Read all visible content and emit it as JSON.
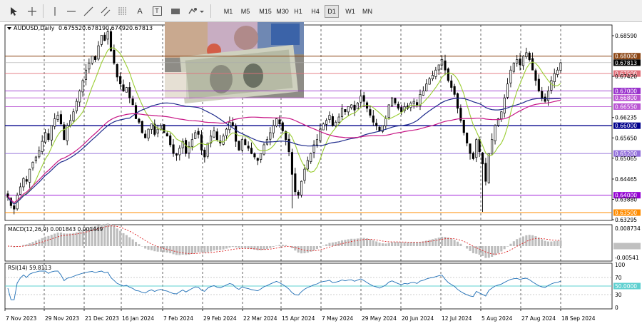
{
  "toolbar": {
    "tools": [
      {
        "name": "cursor-icon"
      },
      {
        "name": "crosshair-icon"
      },
      {
        "name": "vertical-line-icon"
      },
      {
        "name": "horizontal-line-icon"
      },
      {
        "name": "trendline-icon"
      },
      {
        "name": "equidistant-channel-icon"
      },
      {
        "name": "fibonacci-icon"
      },
      {
        "name": "text-icon"
      },
      {
        "name": "text-label-icon"
      },
      {
        "name": "rectangle-icon"
      },
      {
        "name": "shapes-dropdown-icon"
      }
    ],
    "text_tool": "A",
    "text_label_tool": "T",
    "timeframes": [
      "M1",
      "M5",
      "M15",
      "M30",
      "H1",
      "H4",
      "D1",
      "W1",
      "MN"
    ],
    "active_timeframe": "D1"
  },
  "chart": {
    "header": {
      "symbol": "AUDUSD,Daily",
      "open": "0.67552",
      "high": "0.67819",
      "low": "0.67492",
      "close": "0.67813"
    },
    "price_axis": [
      "0.68590",
      "0.67420",
      "0.66235",
      "0.65650",
      "0.65065",
      "0.64465",
      "0.63880",
      "0.63295"
    ],
    "current_price": "0.67813",
    "levels": [
      {
        "label": "0.68000",
        "value": 0.68,
        "color": "#8b4513"
      },
      {
        "label": "0.67500",
        "value": 0.675,
        "color": "#e0707a"
      },
      {
        "label": "0.67000",
        "value": 0.67,
        "color": "#9932cc"
      },
      {
        "label": "0.66800",
        "value": 0.668,
        "color": "#ba55d3"
      },
      {
        "label": "0.66550",
        "value": 0.6655,
        "color": "#ba55d3"
      },
      {
        "label": "0.66000",
        "value": 0.66,
        "color": "#00008b"
      },
      {
        "label": "0.65200",
        "value": 0.652,
        "color": "#9370db"
      },
      {
        "label": "0.64000",
        "value": 0.64,
        "color": "#9400d3"
      },
      {
        "label": "0.63500",
        "value": 0.635,
        "color": "#ff8c00"
      }
    ],
    "date_axis": [
      "7 Nov 2023",
      "29 Nov 2023",
      "21 Dec 2023",
      "16 Jan 2024",
      "7 Feb 2024",
      "29 Feb 2024",
      "22 Mar 2024",
      "15 Apr 2024",
      "7 May 2024",
      "29 May 2024",
      "20 Jun 2024",
      "12 Jul 2024",
      "5 Aug 2024",
      "27 Aug 2024",
      "18 Sep 2024"
    ],
    "closes": [
      0.6394,
      0.637,
      0.636,
      0.64,
      0.6424,
      0.6448,
      0.644,
      0.6475,
      0.6495,
      0.651,
      0.6528,
      0.6555,
      0.658,
      0.656,
      0.66,
      0.662,
      0.663,
      0.6605,
      0.656,
      0.66,
      0.6615,
      0.664,
      0.667,
      0.67,
      0.673,
      0.676,
      0.678,
      0.68,
      0.679,
      0.683,
      0.686,
      0.6845,
      0.687,
      0.6815,
      0.678,
      0.674,
      0.672,
      0.67,
      0.671,
      0.668,
      0.666,
      0.662,
      0.661,
      0.658,
      0.6565,
      0.659,
      0.6605,
      0.6575,
      0.659,
      0.66,
      0.658,
      0.657,
      0.6545,
      0.652,
      0.6515,
      0.6535,
      0.6555,
      0.652,
      0.654,
      0.656,
      0.658,
      0.6575,
      0.653,
      0.651,
      0.655,
      0.657,
      0.6585,
      0.656,
      0.655,
      0.657,
      0.659,
      0.661,
      0.66,
      0.6555,
      0.653,
      0.656,
      0.6545,
      0.6535,
      0.652,
      0.651,
      0.65,
      0.652,
      0.6545,
      0.656,
      0.658,
      0.66,
      0.662,
      0.6605,
      0.6585,
      0.656,
      0.6525,
      0.646,
      0.641,
      0.64,
      0.644,
      0.6475,
      0.65,
      0.652,
      0.6545,
      0.656,
      0.659,
      0.6605,
      0.6615,
      0.663,
      0.66,
      0.661,
      0.6625,
      0.665,
      0.664,
      0.6655,
      0.666,
      0.6645,
      0.6665,
      0.6685,
      0.667,
      0.665,
      0.663,
      0.661,
      0.66,
      0.6585,
      0.66,
      0.662,
      0.666,
      0.668,
      0.6665,
      0.665,
      0.664,
      0.6655,
      0.665,
      0.6665,
      0.667,
      0.666,
      0.669,
      0.67,
      0.672,
      0.6735,
      0.6745,
      0.676,
      0.6775,
      0.679,
      0.676,
      0.673,
      0.671,
      0.669,
      0.665,
      0.6615,
      0.658,
      0.655,
      0.652,
      0.6505,
      0.656,
      0.6525,
      0.649,
      0.644,
      0.652,
      0.656,
      0.66,
      0.662,
      0.664,
      0.668,
      0.672,
      0.676,
      0.678,
      0.679,
      0.6775,
      0.68,
      0.681,
      0.679,
      0.676,
      0.673,
      0.67,
      0.668,
      0.667,
      0.67,
      0.673,
      0.675,
      0.676,
      0.6781
    ],
    "ma_fast_color": "#9acd32",
    "ma_mid_color": "#1e2a8c",
    "ma_slow_color": "#c71585",
    "macd": {
      "label": "MACD(12,26,9) 0.001843 0.001449",
      "axis": [
        "0.008734",
        "0.000000",
        "-0.00541"
      ]
    },
    "rsi": {
      "label": "RSI(14) 59.8113",
      "axis": [
        "100",
        "70",
        "50",
        "30",
        "0"
      ],
      "level_label": "50.0000"
    },
    "photo": {
      "name": "banknotes-photo"
    }
  }
}
